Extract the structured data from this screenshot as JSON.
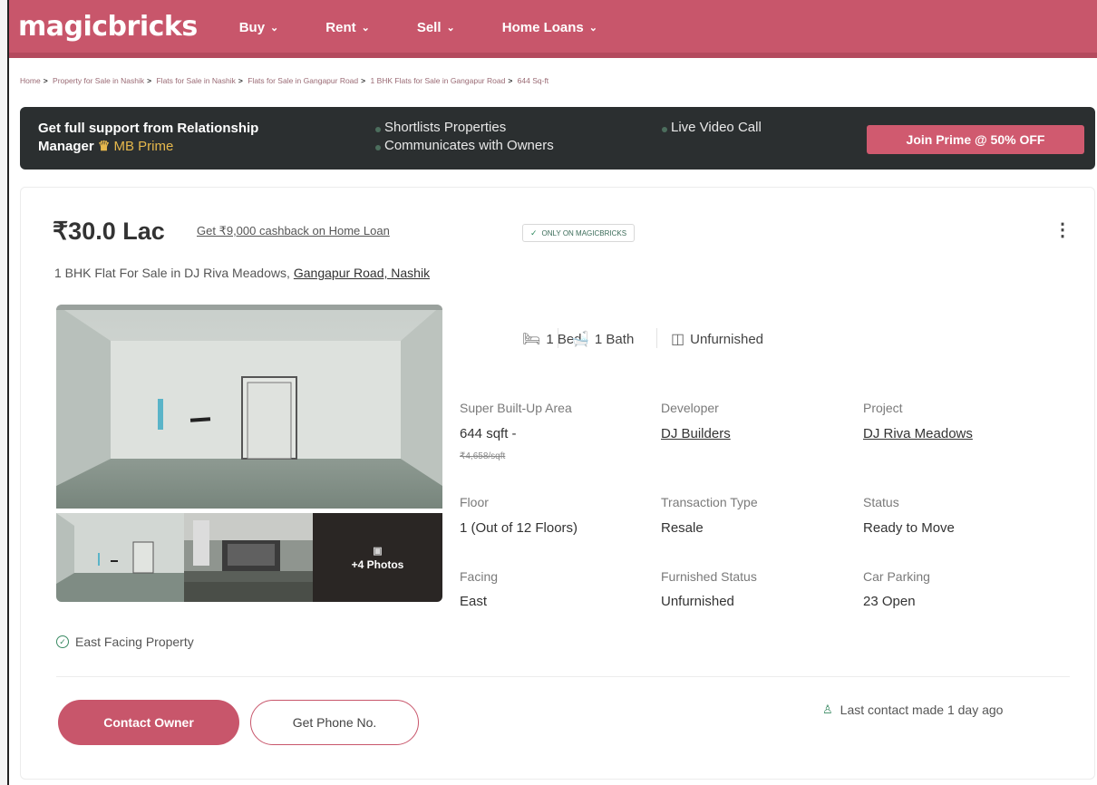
{
  "header": {
    "logo": "magicbricks",
    "nav": [
      {
        "label": "Buy"
      },
      {
        "label": "Rent"
      },
      {
        "label": "Sell"
      },
      {
        "label": "Home Loans"
      }
    ]
  },
  "breadcrumb": [
    "Home",
    "Property for Sale in Nashik",
    "Flats for Sale in Nashik",
    "Flats for Sale in Gangapur Road",
    "1 BHK Flats for Sale in Gangapur Road",
    "644 Sq-ft"
  ],
  "prime_banner": {
    "lead_line1": "Get full support from Relationship",
    "lead_line2": "Manager",
    "prime_label": "MB Prime",
    "features": [
      "Shortlists Properties",
      "Communicates with Owners",
      "Live Video Call"
    ],
    "cta": "Join Prime @ 50% OFF"
  },
  "listing": {
    "price": "₹30.0 Lac",
    "cashback": "Get ₹9,000 cashback on Home Loan",
    "badge": "ONLY ON MAGICBRICKS",
    "title": "1 BHK Flat For Sale in DJ Riva Meadows,",
    "location": "Gangapur Road, Nashik",
    "more_photos": "+4 Photos",
    "highlight": "East Facing Property",
    "amenities": {
      "bed": "1 Bed",
      "bath": "1 Bath",
      "furnishing": "Unfurnished"
    },
    "details": {
      "area_label": "Super Built-Up Area",
      "area_value": "644 sqft -",
      "price_per_sqft": "₹4,658/sqft",
      "developer_label": "Developer",
      "developer_value": "DJ Builders",
      "project_label": "Project",
      "project_value": "DJ Riva Meadows",
      "floor_label": "Floor",
      "floor_value": "1 (Out of 12 Floors)",
      "transaction_label": "Transaction Type",
      "transaction_value": "Resale",
      "status_label": "Status",
      "status_value": "Ready to Move",
      "facing_label": "Facing",
      "facing_value": "East",
      "furnished_label": "Furnished Status",
      "furnished_value": "Unfurnished",
      "parking_label": "Car Parking",
      "parking_value": "23 Open"
    },
    "actions": {
      "contact": "Contact Owner",
      "phone": "Get Phone No."
    },
    "last_contact": "Last contact made 1 day ago"
  },
  "colors": {
    "brand": "#c8566b",
    "banner_bg": "#2b2f30",
    "prime_gold": "#e6b84c",
    "success": "#3a8a63"
  }
}
